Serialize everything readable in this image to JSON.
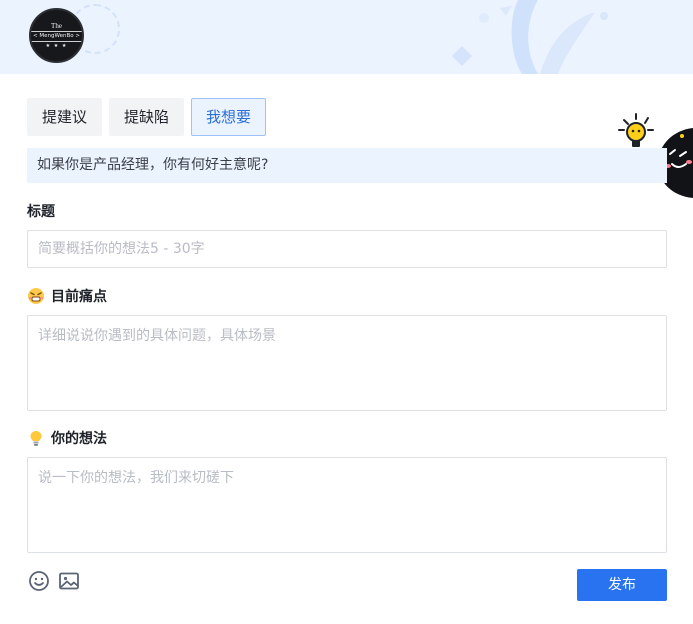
{
  "header": {
    "logo": {
      "top": "The",
      "middle": "< MengWenBo >",
      "bottom": "★ ★ ★"
    }
  },
  "tabs": [
    {
      "label": "提建议",
      "active": false
    },
    {
      "label": "提缺陷",
      "active": false
    },
    {
      "label": "我想要",
      "active": true
    }
  ],
  "hint": "如果你是产品经理，你有何好主意呢?",
  "form": {
    "title": {
      "label": "标题",
      "value": "",
      "placeholder": "简要概括你的想法5 - 30字"
    },
    "pain_point": {
      "label": "目前痛点",
      "value": "",
      "placeholder": "详细说说你遇到的具体问题，具体场景"
    },
    "idea": {
      "label": "你的想法",
      "value": "",
      "placeholder": "说一下你的想法，我们来切磋下"
    }
  },
  "toolbar": {
    "emoji_icon": "smiley-icon",
    "image_icon": "image-icon"
  },
  "publish_label": "发布",
  "colors": {
    "accent": "#2a73f0",
    "band": "#ebf3ff",
    "active_tab_text": "#2b6fd6"
  }
}
